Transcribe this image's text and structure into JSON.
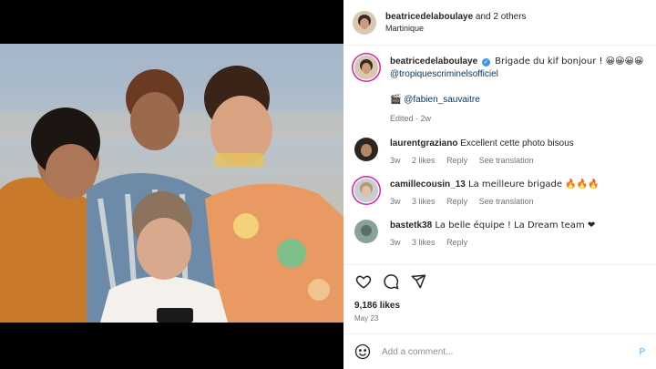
{
  "header": {
    "username": "beatricedelaboulaye",
    "and_others": " and 2 others",
    "location": "Martinique"
  },
  "caption": {
    "username": "beatricedelaboulaye",
    "verified_icon": "verified-badge",
    "text": " Brigade du kif bonjour ! 😀😀😀😀",
    "mention1": "@tropiquescriminelsofficiel",
    "clapper": "🎬",
    "mention2": "@fabien_sauvaitre",
    "edited": "Edited · 2w"
  },
  "comments": [
    {
      "username": "laurentgraziano",
      "text": " Excellent cette photo bisous",
      "time": "3w",
      "likes": "2 likes",
      "reply": "Reply",
      "translate": "See translation"
    },
    {
      "username": "camillecousin_13",
      "text": " La meilleure brigade 🔥🔥🔥",
      "time": "3w",
      "likes": "3 likes",
      "reply": "Reply",
      "translate": "See translation"
    },
    {
      "username": "bastetk38",
      "text": " La belle équipe ! La Dream team ❤",
      "time": "3w",
      "likes": "3 likes",
      "reply": "Reply",
      "translate": ""
    }
  ],
  "actions": {
    "like_icon": "heart-icon",
    "comment_icon": "comment-icon",
    "share_icon": "share-icon"
  },
  "likes_count": "9,186 likes",
  "post_date": "May 23",
  "add_comment": {
    "placeholder": "Add a comment...",
    "emoji_icon": "emoji-icon",
    "post_label": "P"
  },
  "colors": {
    "link": "#00376b",
    "meta": "#737373",
    "accent": "#0095f6",
    "verified": "#3897f0"
  }
}
